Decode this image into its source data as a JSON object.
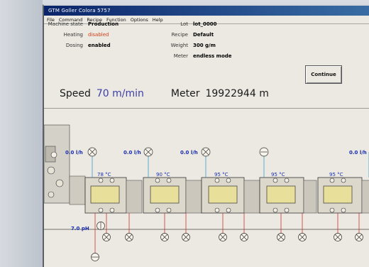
{
  "window": {
    "title": "GTM Goller Colora 5757",
    "menu": [
      "File",
      "Command",
      "Recipe",
      "Function",
      "Options",
      "Help"
    ]
  },
  "status": {
    "machine_state_label": "Machine state",
    "machine_state_value": "Production",
    "heating_label": "Heating",
    "heating_value": "disabled",
    "dosing_label": "Dosing",
    "dosing_value": "enabled"
  },
  "recipe_info": {
    "lot_label": "Lot",
    "lot_value": "lot_0000",
    "recipe_label": "Recipe",
    "recipe_value": "Default",
    "weight_label": "Weight",
    "weight_value": "300 g/m",
    "meter_label": "Meter",
    "meter_value": "endless mode"
  },
  "buttons": {
    "continue": "Continue"
  },
  "readouts": {
    "speed_label": "Speed",
    "speed_value": "70 m/min",
    "meter_label": "Meter",
    "meter_value": "19922944 m"
  },
  "schematic": {
    "flows": [
      "0.0 l/h",
      "0.0 l/h",
      "0.0 l/h",
      "0.0 l/h"
    ],
    "temps": [
      "78 °C",
      "90 °C",
      "95 °C",
      "95 °C",
      "95 °C"
    ],
    "ph": "7.0 pH"
  },
  "colors": {
    "titlebar": "#0a246a",
    "accent_blue": "#3b3fa8",
    "alert_red": "#d63a1a",
    "tank_yellow": "#e8df9a"
  }
}
